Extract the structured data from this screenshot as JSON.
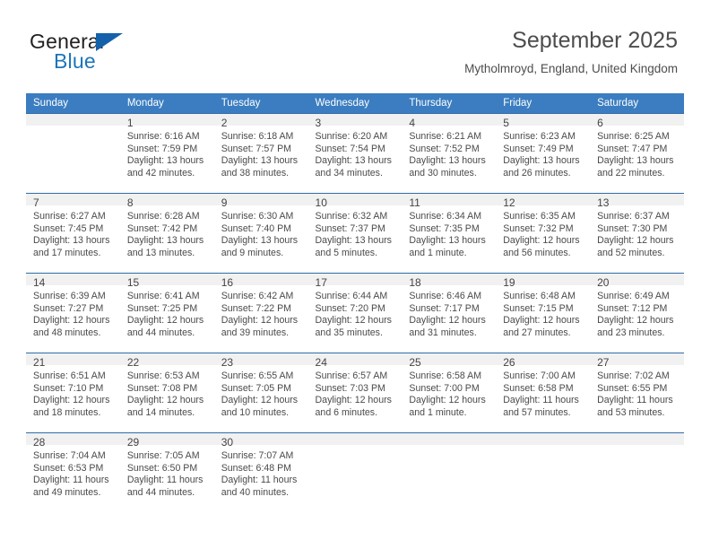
{
  "brand": {
    "name_top": "General",
    "name_bottom": "Blue",
    "accent_color": "#1b75bb",
    "triangle_color": "#1461ab"
  },
  "header": {
    "title": "September 2025",
    "subtitle": "Mytholmroyd, England, United Kingdom",
    "header_bg": "#3b7dc0",
    "row_separator_color": "#2e6da8",
    "daynum_bg": "#f1f1f1"
  },
  "calendar": {
    "weekday_headers": [
      "Sunday",
      "Monday",
      "Tuesday",
      "Wednesday",
      "Thursday",
      "Friday",
      "Saturday"
    ],
    "weeks": [
      [
        {
          "day": "",
          "lines": []
        },
        {
          "day": "1",
          "lines": [
            "Sunrise: 6:16 AM",
            "Sunset: 7:59 PM",
            "Daylight: 13 hours",
            "and 42 minutes."
          ]
        },
        {
          "day": "2",
          "lines": [
            "Sunrise: 6:18 AM",
            "Sunset: 7:57 PM",
            "Daylight: 13 hours",
            "and 38 minutes."
          ]
        },
        {
          "day": "3",
          "lines": [
            "Sunrise: 6:20 AM",
            "Sunset: 7:54 PM",
            "Daylight: 13 hours",
            "and 34 minutes."
          ]
        },
        {
          "day": "4",
          "lines": [
            "Sunrise: 6:21 AM",
            "Sunset: 7:52 PM",
            "Daylight: 13 hours",
            "and 30 minutes."
          ]
        },
        {
          "day": "5",
          "lines": [
            "Sunrise: 6:23 AM",
            "Sunset: 7:49 PM",
            "Daylight: 13 hours",
            "and 26 minutes."
          ]
        },
        {
          "day": "6",
          "lines": [
            "Sunrise: 6:25 AM",
            "Sunset: 7:47 PM",
            "Daylight: 13 hours",
            "and 22 minutes."
          ]
        }
      ],
      [
        {
          "day": "7",
          "lines": [
            "Sunrise: 6:27 AM",
            "Sunset: 7:45 PM",
            "Daylight: 13 hours",
            "and 17 minutes."
          ]
        },
        {
          "day": "8",
          "lines": [
            "Sunrise: 6:28 AM",
            "Sunset: 7:42 PM",
            "Daylight: 13 hours",
            "and 13 minutes."
          ]
        },
        {
          "day": "9",
          "lines": [
            "Sunrise: 6:30 AM",
            "Sunset: 7:40 PM",
            "Daylight: 13 hours",
            "and 9 minutes."
          ]
        },
        {
          "day": "10",
          "lines": [
            "Sunrise: 6:32 AM",
            "Sunset: 7:37 PM",
            "Daylight: 13 hours",
            "and 5 minutes."
          ]
        },
        {
          "day": "11",
          "lines": [
            "Sunrise: 6:34 AM",
            "Sunset: 7:35 PM",
            "Daylight: 13 hours",
            "and 1 minute."
          ]
        },
        {
          "day": "12",
          "lines": [
            "Sunrise: 6:35 AM",
            "Sunset: 7:32 PM",
            "Daylight: 12 hours",
            "and 56 minutes."
          ]
        },
        {
          "day": "13",
          "lines": [
            "Sunrise: 6:37 AM",
            "Sunset: 7:30 PM",
            "Daylight: 12 hours",
            "and 52 minutes."
          ]
        }
      ],
      [
        {
          "day": "14",
          "lines": [
            "Sunrise: 6:39 AM",
            "Sunset: 7:27 PM",
            "Daylight: 12 hours",
            "and 48 minutes."
          ]
        },
        {
          "day": "15",
          "lines": [
            "Sunrise: 6:41 AM",
            "Sunset: 7:25 PM",
            "Daylight: 12 hours",
            "and 44 minutes."
          ]
        },
        {
          "day": "16",
          "lines": [
            "Sunrise: 6:42 AM",
            "Sunset: 7:22 PM",
            "Daylight: 12 hours",
            "and 39 minutes."
          ]
        },
        {
          "day": "17",
          "lines": [
            "Sunrise: 6:44 AM",
            "Sunset: 7:20 PM",
            "Daylight: 12 hours",
            "and 35 minutes."
          ]
        },
        {
          "day": "18",
          "lines": [
            "Sunrise: 6:46 AM",
            "Sunset: 7:17 PM",
            "Daylight: 12 hours",
            "and 31 minutes."
          ]
        },
        {
          "day": "19",
          "lines": [
            "Sunrise: 6:48 AM",
            "Sunset: 7:15 PM",
            "Daylight: 12 hours",
            "and 27 minutes."
          ]
        },
        {
          "day": "20",
          "lines": [
            "Sunrise: 6:49 AM",
            "Sunset: 7:12 PM",
            "Daylight: 12 hours",
            "and 23 minutes."
          ]
        }
      ],
      [
        {
          "day": "21",
          "lines": [
            "Sunrise: 6:51 AM",
            "Sunset: 7:10 PM",
            "Daylight: 12 hours",
            "and 18 minutes."
          ]
        },
        {
          "day": "22",
          "lines": [
            "Sunrise: 6:53 AM",
            "Sunset: 7:08 PM",
            "Daylight: 12 hours",
            "and 14 minutes."
          ]
        },
        {
          "day": "23",
          "lines": [
            "Sunrise: 6:55 AM",
            "Sunset: 7:05 PM",
            "Daylight: 12 hours",
            "and 10 minutes."
          ]
        },
        {
          "day": "24",
          "lines": [
            "Sunrise: 6:57 AM",
            "Sunset: 7:03 PM",
            "Daylight: 12 hours",
            "and 6 minutes."
          ]
        },
        {
          "day": "25",
          "lines": [
            "Sunrise: 6:58 AM",
            "Sunset: 7:00 PM",
            "Daylight: 12 hours",
            "and 1 minute."
          ]
        },
        {
          "day": "26",
          "lines": [
            "Sunrise: 7:00 AM",
            "Sunset: 6:58 PM",
            "Daylight: 11 hours",
            "and 57 minutes."
          ]
        },
        {
          "day": "27",
          "lines": [
            "Sunrise: 7:02 AM",
            "Sunset: 6:55 PM",
            "Daylight: 11 hours",
            "and 53 minutes."
          ]
        }
      ],
      [
        {
          "day": "28",
          "lines": [
            "Sunrise: 7:04 AM",
            "Sunset: 6:53 PM",
            "Daylight: 11 hours",
            "and 49 minutes."
          ]
        },
        {
          "day": "29",
          "lines": [
            "Sunrise: 7:05 AM",
            "Sunset: 6:50 PM",
            "Daylight: 11 hours",
            "and 44 minutes."
          ]
        },
        {
          "day": "30",
          "lines": [
            "Sunrise: 7:07 AM",
            "Sunset: 6:48 PM",
            "Daylight: 11 hours",
            "and 40 minutes."
          ]
        },
        {
          "day": "",
          "lines": []
        },
        {
          "day": "",
          "lines": []
        },
        {
          "day": "",
          "lines": []
        },
        {
          "day": "",
          "lines": []
        }
      ]
    ]
  }
}
